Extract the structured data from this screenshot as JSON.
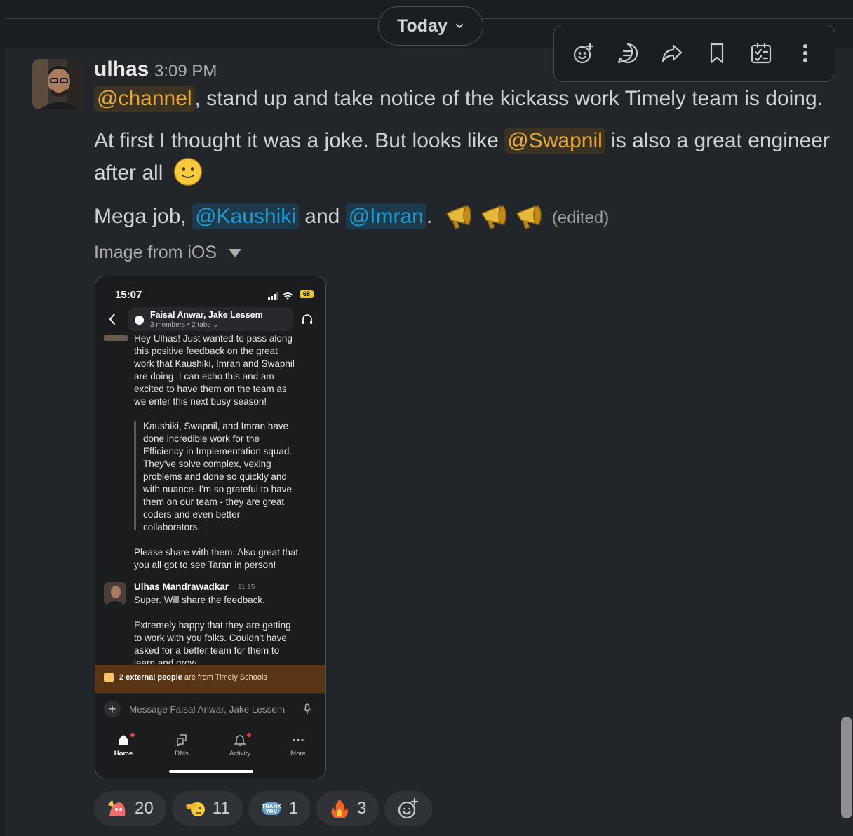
{
  "date_divider": {
    "label": "Today"
  },
  "message": {
    "sender": "ulhas",
    "time": "3:09 PM",
    "line1": {
      "mention": "@channel",
      "text": ", stand up and take notice of the kickass work Timely team is doing."
    },
    "line2": {
      "before": "At first I thought it was a joke. But looks like ",
      "mention": "@Swapnil",
      "after": " is also a great engineer"
    },
    "line3": {
      "text": "after all",
      "emoji": "slightly-smiling-face-emoji"
    },
    "line4": {
      "prefix": "Mega job, ",
      "mention1": "@Kaushiki",
      "middle": " and ",
      "mention2": "@Imran",
      "suffix": ".",
      "emoji": "megaphone-emoji",
      "edited": "(edited)"
    },
    "attachment_label": "Image from iOS"
  },
  "phone": {
    "status_time": "15:07",
    "battery": "68",
    "header_title": "Faisal Anwar, Jake Lessem",
    "header_sub": "3 members • 2 tabs ⌄",
    "msg1": "Hey Ulhas! Just wanted to pass along\nthis positive feedback on the great\nwork that Kaushiki, Imran and Swapnil\nare doing. I can echo this and am\nexcited to have them on the team as\nwe enter this next busy season!",
    "quote": "Kaushiki, Swapnil, and Imran have\ndone incredible work for the\nEfficiency in Implementation squad.\nThey've solve complex, vexing\nproblems and done so quickly and\nwith nuance. I'm so grateful to have\nthem on our team - they are great\ncoders and even better\ncollaborators.",
    "msg2": "Please share with them. Also great that\nyou all got to see Taran in person!",
    "reply_name": "Ulhas Mandrawadkar",
    "reply_time": "11:15",
    "reply1": "Super. Will share the feedback.",
    "reply2": "Extremely happy that they are getting\nto work with you folks. Couldn't have\nasked for a better team for them to\nlearn and grow",
    "banner_bold": "2 external people",
    "banner_rest": " are from Timely Schools",
    "compose_placeholder": "Message Faisal Anwar, Jake Lessem",
    "nav": [
      "Home",
      "DMs",
      "Activity",
      "More"
    ]
  },
  "reactions": [
    {
      "emoji": "party-blob-emoji",
      "count": "20"
    },
    {
      "emoji": "salute-emoji",
      "count": "11"
    },
    {
      "emoji": "thank-you-emoji",
      "count": "1"
    },
    {
      "emoji": "fire-emoji",
      "count": "3"
    }
  ],
  "toolbar_icons": [
    "add-reaction-icon",
    "reply-in-thread-icon",
    "forward-icon",
    "bookmark-icon",
    "create-list-icon",
    "more-actions-icon"
  ]
}
